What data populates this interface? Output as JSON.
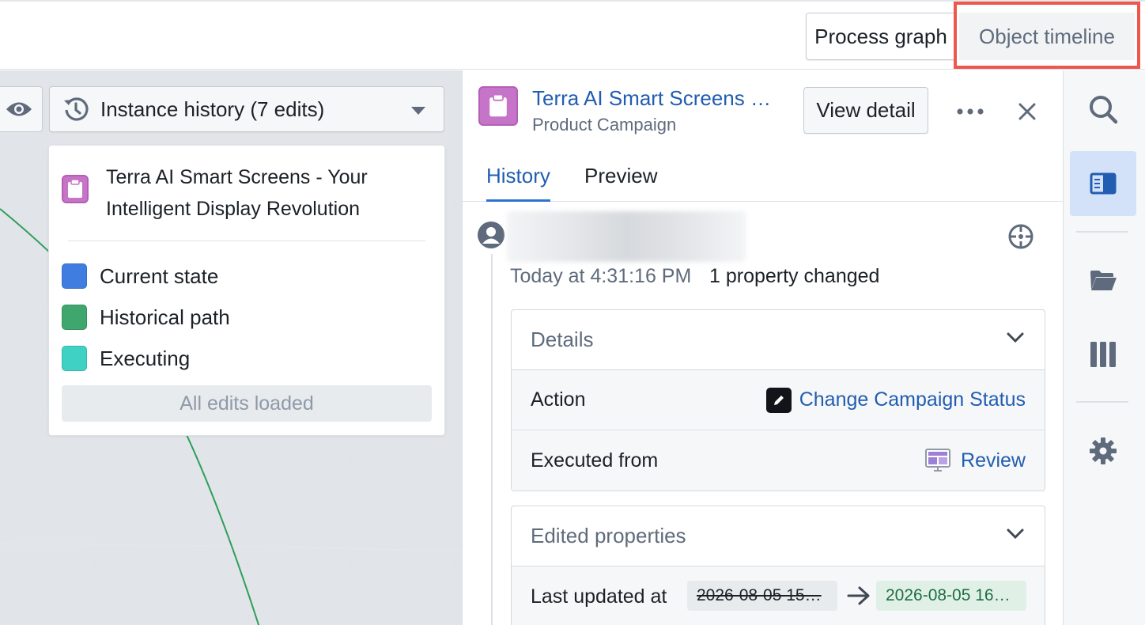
{
  "view_switcher": {
    "process_graph": "Process graph",
    "object_timeline": "Object timeline"
  },
  "graph": {
    "history_select_label": "Instance history (7 edits)",
    "legend": {
      "object_title": "Terra AI Smart Screens - Your Intelligent Display Revolution",
      "items": [
        {
          "label": "Current state",
          "color": "#3f7ee0"
        },
        {
          "label": "Historical path",
          "color": "#3fa66e"
        },
        {
          "label": "Executing",
          "color": "#3fd1c4"
        }
      ],
      "all_edits_loaded": "All edits loaded"
    }
  },
  "panel": {
    "object_title": "Terra AI Smart Screens -…",
    "object_type": "Product Campaign",
    "view_detail": "View detail",
    "tabs": [
      "History",
      "Preview"
    ],
    "entry": {
      "time": "Today at 4:31:16 PM",
      "summary": "1 property changed",
      "details": {
        "header": "Details",
        "rows": [
          {
            "label": "Action",
            "value": "Change Campaign Status"
          },
          {
            "label": "Executed from",
            "value": "Review"
          }
        ]
      },
      "edited_properties": {
        "header": "Edited properties",
        "rows": [
          {
            "label": "Last updated at",
            "old": "2026-08-05 15…",
            "new": "2026-08-05 16…"
          }
        ]
      }
    }
  },
  "colors": {
    "accent_blue": "#215db0",
    "object_icon": "#c674c8",
    "highlight": "#f0564c"
  }
}
